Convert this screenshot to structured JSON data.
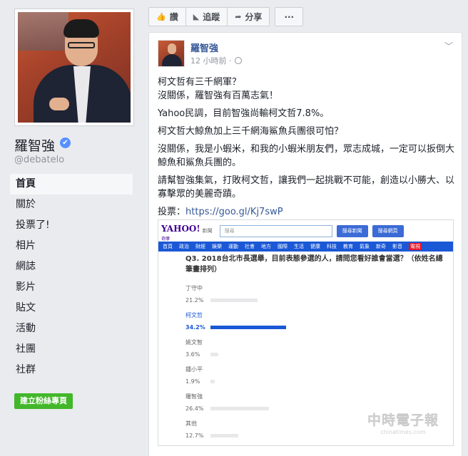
{
  "page": {
    "name": "羅智強",
    "handle": "@debatelo",
    "verified_icon": "✔",
    "create_page_label": "建立粉絲專頁"
  },
  "nav": {
    "items": [
      "首頁",
      "關於",
      "投票了!",
      "相片",
      "網誌",
      "影片",
      "貼文",
      "活動",
      "社團",
      "社群"
    ]
  },
  "actions": {
    "like": "讚",
    "follow": "追蹤",
    "share": "分享",
    "more": "···"
  },
  "post": {
    "author": "羅智強",
    "time": "12 小時前 ·",
    "paragraphs": [
      "柯文哲有三千網軍？",
      "沒關係，羅智強有百萬志氣！",
      "Yahoo民調，目前智強尚輸柯文哲7.8%。",
      "柯文哲大鯨魚加上三千網海鯊魚兵團很可怕？",
      "沒關係，我是小蝦米，和我的小蝦米朋友們，眾志成城，一定可以扳倒大鯨魚和鯊魚兵團的。",
      "請幫智強集氣，打敗柯文哲，讓我們一起挑戰不可能，創造以小勝大、以寡擊眾的美麗奇蹟。"
    ],
    "vote_prefix": "投票：",
    "vote_link": "https://goo.gl/Kj7swP"
  },
  "embed": {
    "logo": "YAHOO!",
    "logo_sub": "奇摩",
    "news_label": "新聞",
    "search_placeholder": "搜尋",
    "search_news_btn": "搜尋新聞",
    "search_web_btn": "搜尋網頁",
    "nav": [
      "首頁",
      "政治",
      "財經",
      "娛樂",
      "運動",
      "社會",
      "地方",
      "國際",
      "生活",
      "健康",
      "科技",
      "教育",
      "氣象",
      "新奇",
      "影音"
    ],
    "nav_last": "電視",
    "question": "Q3. 2018台北市長選舉，目前表態參選的人，請問您看好誰會當選？（依姓名總筆畫排列）"
  },
  "chart_data": {
    "type": "bar",
    "categories": [
      "丁守中",
      "柯文哲",
      "姚文智",
      "鍾小平",
      "羅智強",
      "其他"
    ],
    "values": [
      21.2,
      34.2,
      3.6,
      1.9,
      26.4,
      12.7
    ],
    "value_labels": [
      "21.2%",
      "34.2%",
      "3.6%",
      "1.9%",
      "26.4%",
      "12.7%"
    ],
    "highlight": "柯文哲",
    "colors": {
      "bar": "#e8e8ea",
      "highlight": "#1a58d6"
    },
    "title": "Q3. 2018台北市長選舉，目前表態參選的人，請問您看好誰會當選？（依姓名總筆畫排列）",
    "xlabel": "",
    "ylabel": "",
    "ylim": [
      0,
      100
    ]
  },
  "watermark": {
    "main": "中時電子報",
    "url": "chinatimes.com"
  }
}
